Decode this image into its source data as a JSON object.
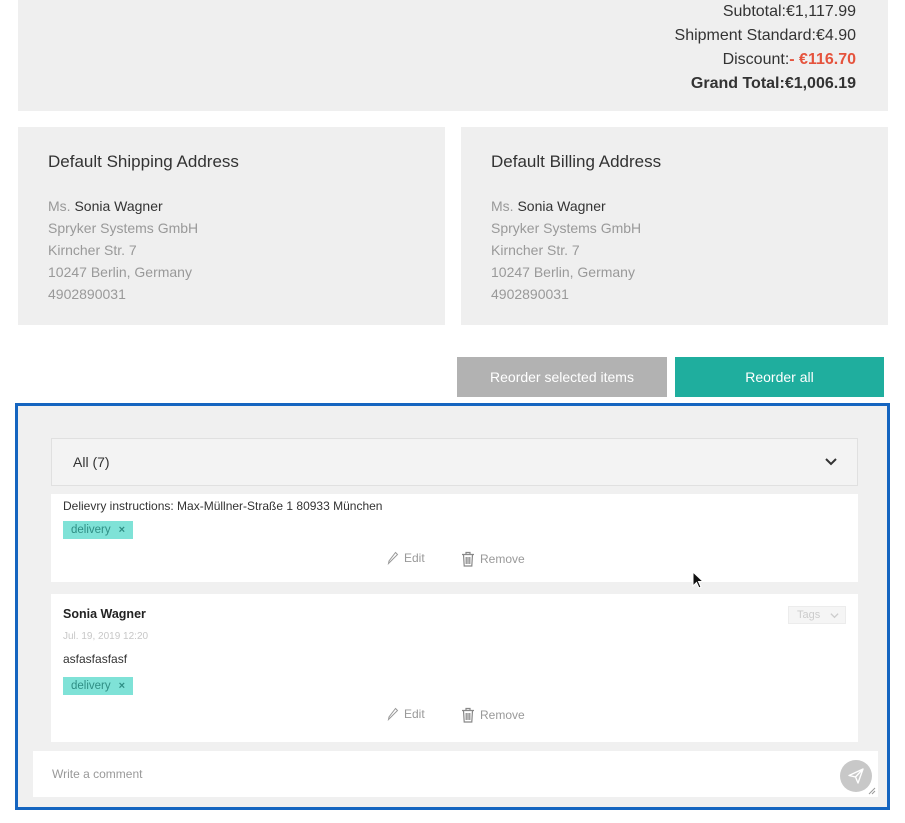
{
  "totals": {
    "subtotal_label": "Subtotal:",
    "subtotal_value": "€1,117.99",
    "shipment_label": "Shipment Standard:",
    "shipment_value": "€4.90",
    "discount_label": "Discount:",
    "discount_value": "- €116.70",
    "grand_label": "Grand Total:",
    "grand_value": "€1,006.19"
  },
  "shipping": {
    "title": "Default Shipping Address",
    "salutation": "Ms.",
    "name": "Sonia Wagner",
    "company": "Spryker Systems GmbH",
    "street": "Kirncher Str. 7",
    "city": "10247 Berlin, Germany",
    "phone": "4902890031"
  },
  "billing": {
    "title": "Default Billing Address",
    "salutation": "Ms.",
    "name": "Sonia Wagner",
    "company": "Spryker Systems GmbH",
    "street": "Kirncher Str. 7",
    "city": "10247 Berlin, Germany",
    "phone": "4902890031"
  },
  "actions": {
    "reorder_selected": "Reorder selected items",
    "reorder_all": "Reorder all"
  },
  "comments": {
    "filter_label": "All (7)",
    "items": [
      {
        "text": "Delievry instructions: Max-Müllner-Straße 1 80933 München",
        "tag": "delivery",
        "edit": "Edit",
        "remove": "Remove"
      },
      {
        "author": "Sonia Wagner",
        "date": "Jul. 19, 2019 12:20",
        "text": "asfasfasfasf",
        "tag": "delivery",
        "tags_select": "Tags",
        "edit": "Edit",
        "remove": "Remove"
      }
    ],
    "input_placeholder": "Write a comment"
  },
  "colors": {
    "accent": "#1fae9e",
    "discount": "#e5533d",
    "tag_bg": "#7fe2d7",
    "panel_border": "#1565c0"
  }
}
